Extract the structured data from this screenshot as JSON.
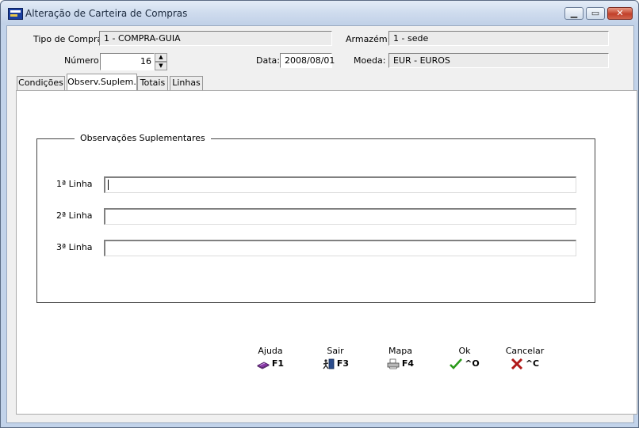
{
  "window": {
    "title": "Alteração de Carteira de Compras"
  },
  "header": {
    "tipo_compra_label": "Tipo de Compra:",
    "tipo_compra_value": "1 - COMPRA-GUIA",
    "armazem_label": "Armazém:",
    "armazem_value": "1 - sede",
    "numero_label": "Número:",
    "numero_value": "16",
    "data_label": "Data:",
    "data_value": "2008/08/01",
    "moeda_label": "Moeda:",
    "moeda_value": "EUR - EUROS"
  },
  "tabs": [
    {
      "label": "Condições",
      "active": false
    },
    {
      "label": "Observ.Suplem.",
      "active": true
    },
    {
      "label": "Totais",
      "active": false
    },
    {
      "label": "Linhas",
      "active": false
    }
  ],
  "group": {
    "title": "Observações Suplementares",
    "lines": [
      {
        "label": "1ª Linha",
        "value": ""
      },
      {
        "label": "2ª Linha",
        "value": ""
      },
      {
        "label": "3ª Linha",
        "value": ""
      }
    ]
  },
  "actions": [
    {
      "caption": "Ajuda",
      "shortcut": "F1",
      "icon": "book-icon"
    },
    {
      "caption": "Sair",
      "shortcut": "F3",
      "icon": "exit-door-icon"
    },
    {
      "caption": "Mapa",
      "shortcut": "F4",
      "icon": "printer-icon"
    },
    {
      "caption": "Ok",
      "shortcut": "^O",
      "icon": "check-icon"
    },
    {
      "caption": "Cancelar",
      "shortcut": "^C",
      "icon": "cancel-x-icon"
    }
  ],
  "colors": {
    "check": "#2a9a1a",
    "cancel": "#b01818",
    "book": "#8a3aa8"
  }
}
